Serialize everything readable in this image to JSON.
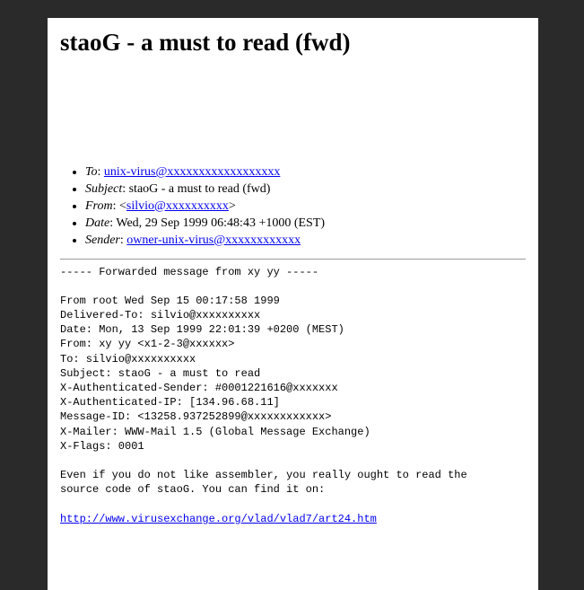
{
  "title": "staoG - a must to read (fwd)",
  "headers": {
    "to_label": "To",
    "to_value": "unix-virus@xxxxxxxxxxxxxxxxxx",
    "subject_label": "Subject",
    "subject_value": "staoG - a must to read (fwd)",
    "from_label": "From",
    "from_value": "silvio@xxxxxxxxxx",
    "date_label": "Date",
    "date_value": "Wed, 29 Sep 1999 06:48:43 +1000 (EST)",
    "sender_label": "Sender",
    "sender_value": "owner-unix-virus@xxxxxxxxxxxx"
  },
  "body": {
    "pre_text": "----- Forwarded message from xy yy -----\n\nFrom root Wed Sep 15 00:17:58 1999\nDelivered-To: silvio@xxxxxxxxxx\nDate: Mon, 13 Sep 1999 22:01:39 +0200 (MEST)\nFrom: xy yy <x1-2-3@xxxxxx>\nTo: silvio@xxxxxxxxxx\nSubject: staoG - a must to read\nX-Authenticated-Sender: #0001221616@xxxxxxx\nX-Authenticated-IP: [134.96.68.11]\nMessage-ID: <13258.937252899@xxxxxxxxxxxx>\nX-Mailer: WWW-Mail 1.5 (Global Message Exchange)\nX-Flags: 0001\n\nEven if you do not like assembler, you really ought to read the\nsource code of staoG. You can find it on:\n\n",
    "link": "http://www.virusexchange.org/vlad/vlad7/art24.htm"
  }
}
